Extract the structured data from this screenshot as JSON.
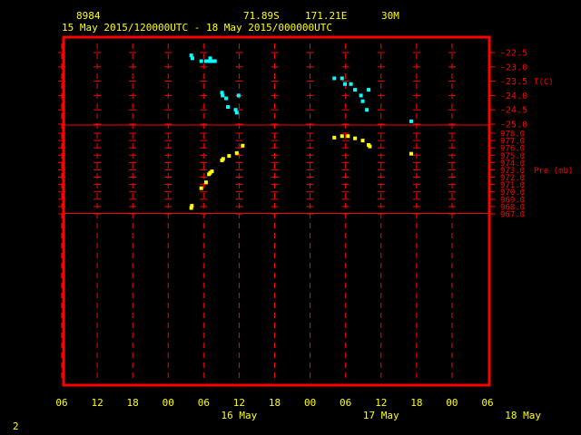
{
  "header": {
    "station_id": "8984",
    "lat": "71.89S",
    "lon": "171.21E",
    "height": "30M",
    "period": "15 May 2015/120000UTC - 18 May 2015/000000UTC"
  },
  "page_number": "2",
  "colors": {
    "frame": "#ff0000",
    "grid": "#ff0000",
    "axis_text": "#ffff00",
    "panel_text": "#ff0000",
    "temperature": "#00ffff",
    "pressure": "#ffff00",
    "background": "#000000"
  },
  "chart_data": {
    "type": "scatter",
    "x_axis": {
      "hours": [
        -6,
        0,
        6,
        12,
        18,
        24,
        30,
        36,
        42,
        48,
        54,
        60
      ],
      "tick_labels": [
        "06",
        "12",
        "18",
        "00",
        "06",
        "12",
        "18",
        "00",
        "06",
        "12",
        "18",
        "00",
        "06"
      ],
      "tick_hours": [
        -6,
        0,
        6,
        12,
        18,
        24,
        30,
        36,
        42,
        48,
        54,
        60,
        66
      ],
      "range_hours": [
        -6,
        66
      ],
      "date_labels": [
        {
          "label": "16 May",
          "hour": 24
        },
        {
          "label": "17 May",
          "hour": 48
        },
        {
          "label": "18 May",
          "hour": 72
        }
      ]
    },
    "panels": [
      {
        "name": "T(C)",
        "ylim": [
          -25.0,
          -22.5
        ],
        "tick_labels": [
          "-22.5",
          "-23.0",
          "-23.5",
          "-24.0",
          "-24.5",
          "-25.0"
        ],
        "tick_values": [
          -22.5,
          -23.0,
          -23.5,
          -24.0,
          -24.5,
          -25.0
        ],
        "points": [
          {
            "x": 15.9,
            "y": -22.6
          },
          {
            "x": 16.1,
            "y": -22.7
          },
          {
            "x": 17.6,
            "y": -22.8
          },
          {
            "x": 18.4,
            "y": -22.8
          },
          {
            "x": 18.9,
            "y": -22.8
          },
          {
            "x": 19.4,
            "y": -22.8
          },
          {
            "x": 19.1,
            "y": -22.7
          },
          {
            "x": 19.9,
            "y": -22.8
          },
          {
            "x": 21.1,
            "y": -23.9
          },
          {
            "x": 21.2,
            "y": -24.0
          },
          {
            "x": 21.8,
            "y": -24.1
          },
          {
            "x": 22.1,
            "y": -24.4
          },
          {
            "x": 23.4,
            "y": -24.5
          },
          {
            "x": 23.6,
            "y": -24.6
          },
          {
            "x": 23.9,
            "y": -24.0
          },
          {
            "x": 40.1,
            "y": -23.4
          },
          {
            "x": 41.4,
            "y": -23.4
          },
          {
            "x": 41.9,
            "y": -23.6
          },
          {
            "x": 42.9,
            "y": -23.6
          },
          {
            "x": 43.6,
            "y": -23.8
          },
          {
            "x": 44.6,
            "y": -24.0
          },
          {
            "x": 44.9,
            "y": -24.2
          },
          {
            "x": 45.6,
            "y": -24.5
          },
          {
            "x": 45.9,
            "y": -23.8
          },
          {
            "x": 53.1,
            "y": -24.9
          }
        ]
      },
      {
        "name": "Pre (mb)",
        "ylim": [
          967.0,
          978.0
        ],
        "tick_labels": [
          "978.0",
          "977.0",
          "976.0",
          "975.0",
          "974.0",
          "973.0",
          "972.0",
          "971.0",
          "970.0",
          "969.0",
          "968.0",
          "967.0"
        ],
        "tick_values": [
          978.0,
          977.0,
          976.0,
          975.0,
          974.0,
          973.0,
          972.0,
          971.0,
          970.0,
          969.0,
          968.0,
          967.0
        ],
        "points": [
          {
            "x": 15.9,
            "y": 967.8
          },
          {
            "x": 16.0,
            "y": 968.1
          },
          {
            "x": 17.6,
            "y": 970.5
          },
          {
            "x": 18.4,
            "y": 971.3
          },
          {
            "x": 18.9,
            "y": 972.4
          },
          {
            "x": 19.1,
            "y": 972.6
          },
          {
            "x": 19.4,
            "y": 972.8
          },
          {
            "x": 21.1,
            "y": 974.3
          },
          {
            "x": 21.3,
            "y": 974.5
          },
          {
            "x": 22.3,
            "y": 974.9
          },
          {
            "x": 23.6,
            "y": 975.3
          },
          {
            "x": 24.6,
            "y": 976.3
          },
          {
            "x": 40.1,
            "y": 977.4
          },
          {
            "x": 41.4,
            "y": 977.6
          },
          {
            "x": 42.4,
            "y": 977.6
          },
          {
            "x": 43.6,
            "y": 977.3
          },
          {
            "x": 44.9,
            "y": 977.0
          },
          {
            "x": 45.9,
            "y": 976.4
          },
          {
            "x": 46.1,
            "y": 976.2
          },
          {
            "x": 53.1,
            "y": 975.2
          }
        ]
      }
    ]
  }
}
